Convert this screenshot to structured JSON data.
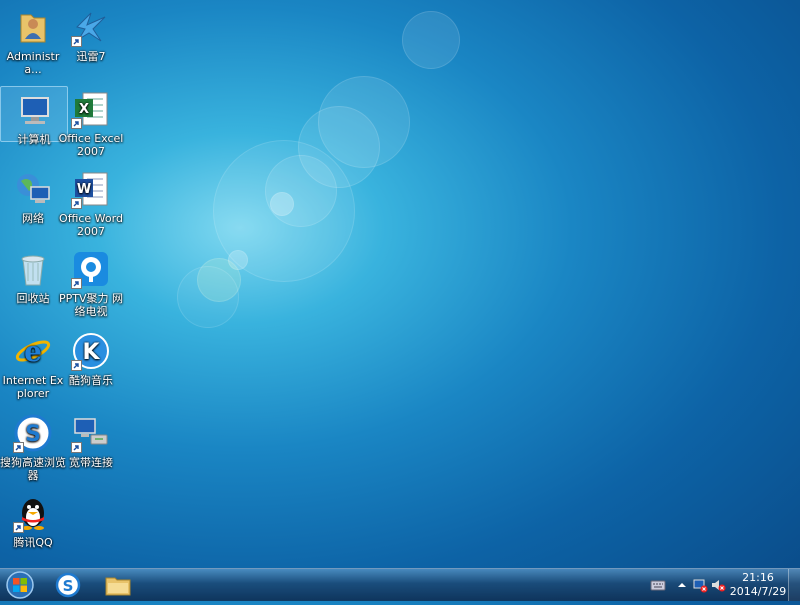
{
  "desktop": {
    "icons": [
      {
        "label": "Administra...",
        "icon": "user-folder-icon"
      },
      {
        "label": "迅雷7",
        "icon": "thunder-icon"
      },
      {
        "label": "计算机",
        "icon": "computer-icon"
      },
      {
        "label": "Office Excel 2007",
        "icon": "excel-icon"
      },
      {
        "label": "网络",
        "icon": "network-icon"
      },
      {
        "label": "Office Word 2007",
        "icon": "word-icon"
      },
      {
        "label": "回收站",
        "icon": "recycle-bin-icon"
      },
      {
        "label": "PPTV聚力 网络电视",
        "icon": "pptv-icon"
      },
      {
        "label": "Internet Explorer",
        "icon": "ie-icon"
      },
      {
        "label": "酷狗音乐",
        "icon": "kugou-icon"
      },
      {
        "label": "搜狗高速浏览器",
        "icon": "sogou-browser-icon"
      },
      {
        "label": "宽带连接",
        "icon": "broadband-icon"
      },
      {
        "label": "腾讯QQ",
        "icon": "qq-icon"
      }
    ]
  },
  "taskbar": {
    "pinned": [
      {
        "name": "sogou-browser",
        "icon": "sogou-browser-icon"
      },
      {
        "name": "file-explorer",
        "icon": "folder-icon"
      }
    ],
    "clock": {
      "time": "21:16",
      "date": "2014/7/29"
    }
  },
  "colors": {
    "accent": "#1a86c4",
    "taskbar": "#0f2d50"
  }
}
